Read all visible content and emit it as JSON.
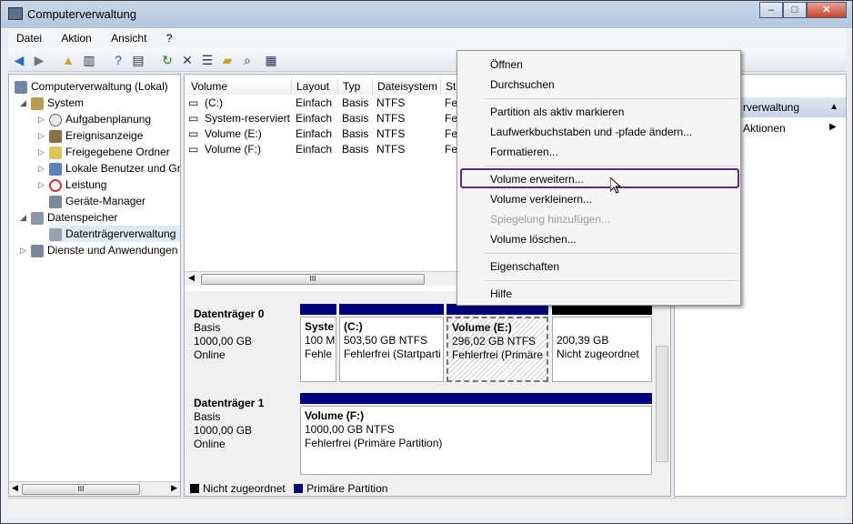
{
  "window": {
    "title": "Computerverwaltung",
    "buttons": [
      "–",
      "□",
      "✕"
    ]
  },
  "menu": [
    "Datei",
    "Aktion",
    "Ansicht",
    "?"
  ],
  "tree": [
    {
      "label": "Computerverwaltung (Lokal)",
      "level": 0,
      "icon": "computer-icon"
    },
    {
      "label": "System",
      "level": 1,
      "icon": "tools-icon"
    },
    {
      "label": "Aufgabenplanung",
      "level": 2,
      "icon": "clock-icon"
    },
    {
      "label": "Ereignisanzeige",
      "level": 2,
      "icon": "event-icon"
    },
    {
      "label": "Freigegebene Ordner",
      "level": 2,
      "icon": "folder-icon"
    },
    {
      "label": "Lokale Benutzer und Gr",
      "level": 2,
      "icon": "users-icon"
    },
    {
      "label": "Leistung",
      "level": 2,
      "icon": "no-icon"
    },
    {
      "label": "Geräte-Manager",
      "level": 2,
      "icon": "device-icon"
    },
    {
      "label": "Datenspeicher",
      "level": 1,
      "icon": "storage-icon"
    },
    {
      "label": "Datenträgerverwaltung",
      "level": 2,
      "icon": "disk-icon"
    },
    {
      "label": "Dienste und Anwendungen",
      "level": 1,
      "icon": "services-icon"
    }
  ],
  "volumes": {
    "headers": [
      "Volume",
      "Layout",
      "Typ",
      "Dateisystem",
      "Sta"
    ],
    "rows": [
      [
        "(C:)",
        "Einfach",
        "Basis",
        "NTFS",
        "Feh"
      ],
      [
        "System-reserviert",
        "Einfach",
        "Basis",
        "NTFS",
        "Feh"
      ],
      [
        "Volume (E:)",
        "Einfach",
        "Basis",
        "NTFS",
        "Feh"
      ],
      [
        "Volume (F:)",
        "Einfach",
        "Basis",
        "NTFS",
        "Feh"
      ]
    ]
  },
  "disks": [
    {
      "name": "Datenträger 0",
      "type": "Basis",
      "size": "1000,00 GB",
      "state": "Online",
      "partitions": [
        {
          "title": "Syste",
          "line1": "100 M",
          "line2": "Fehle"
        },
        {
          "title": "(C:)",
          "line1": "503,50 GB NTFS",
          "line2": "Fehlerfrei (Startparti"
        },
        {
          "title": "Volume  (E:)",
          "line1": "296,02 GB NTFS",
          "line2": "Fehlerfrei (Primäre"
        },
        {
          "title": "",
          "line1": "200,39 GB",
          "line2": "Nicht zugeordnet"
        }
      ]
    },
    {
      "name": "Datenträger 1",
      "type": "Basis",
      "size": "1000,00 GB",
      "state": "Online",
      "partitions": [
        {
          "title": "Volume  (F:)",
          "line1": "1000,00 GB NTFS",
          "line2": "Fehlerfrei (Primäre Partition)"
        }
      ]
    }
  ],
  "legend": [
    "Nicht zugeordnet",
    "Primäre Partition"
  ],
  "actions": {
    "header": "rverwaltung",
    "item": "Aktionen"
  },
  "context_menu": {
    "items": [
      "Öffnen",
      "Durchsuchen",
      "Partition als aktiv markieren",
      "Laufwerkbuchstaben und -pfade ändern...",
      "Formatieren...",
      "Volume erweitern...",
      "Volume verkleinern...",
      "Spiegelung hinzufügen...",
      "Volume löschen...",
      "Eigenschaften",
      "Hilfe"
    ],
    "disabled": [
      "Spiegelung hinzufügen..."
    ],
    "highlighted": "Volume erweitern..."
  },
  "colors": {
    "primary_partition": "#00007f",
    "unallocated": "#000000",
    "highlight": "#5b2a86"
  },
  "scroll_glyph": "III"
}
